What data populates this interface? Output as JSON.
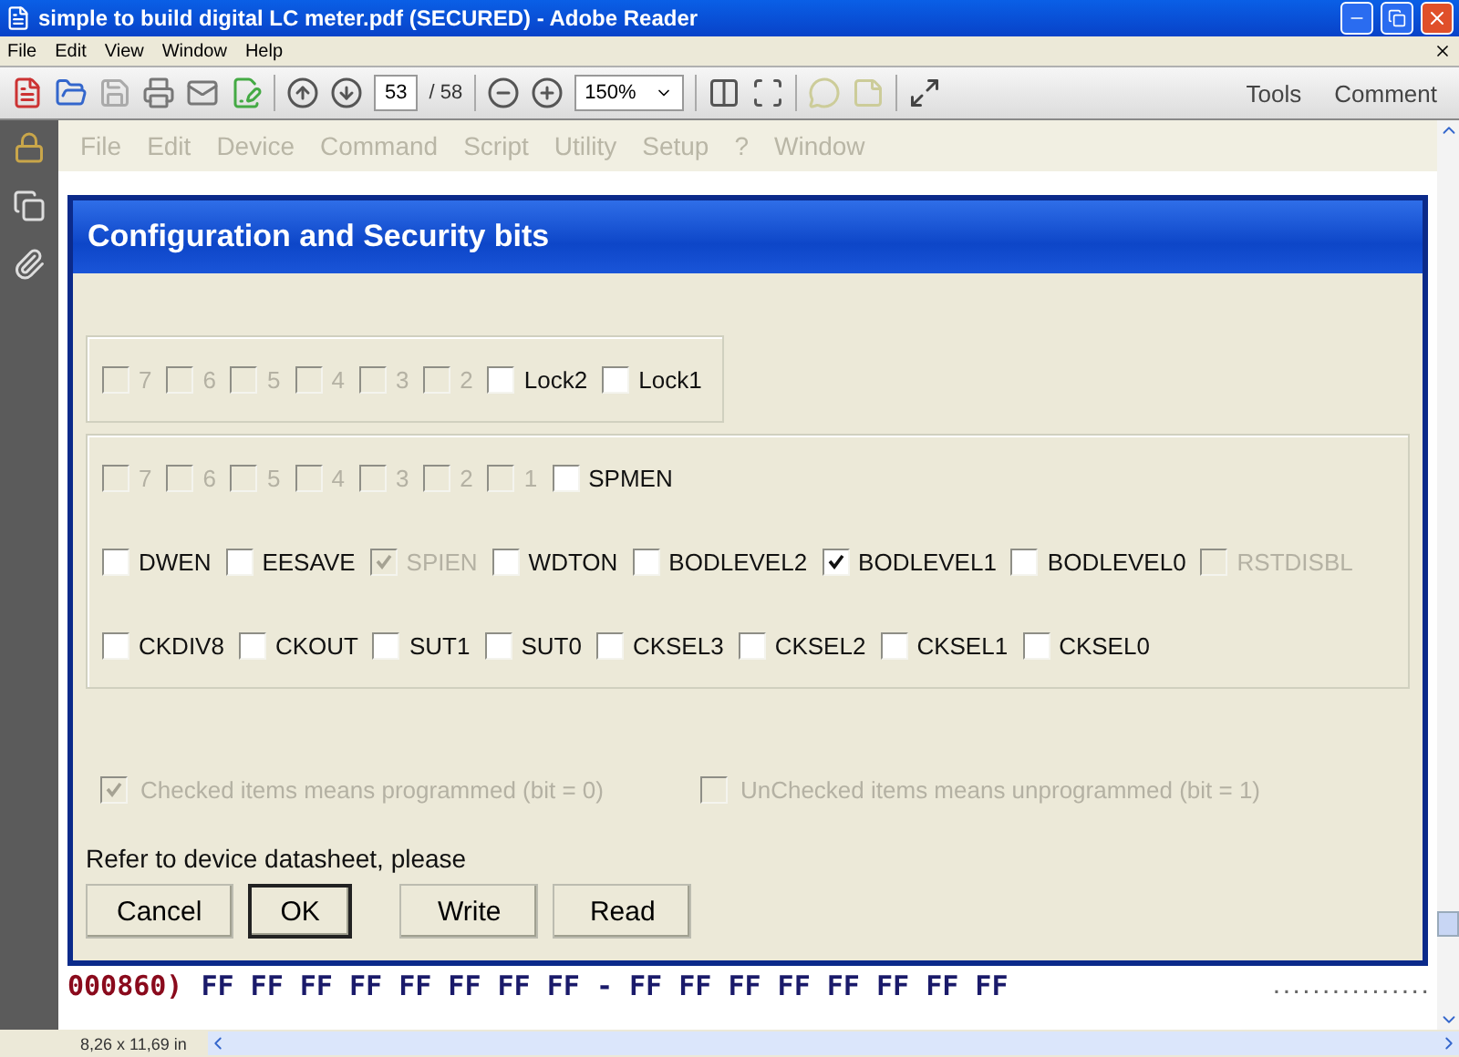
{
  "window": {
    "title": "simple to build digital LC meter.pdf (SECURED) - Adobe Reader"
  },
  "menu": [
    "File",
    "Edit",
    "View",
    "Window",
    "Help"
  ],
  "toolbar": {
    "page": "53",
    "page_count": "/ 58",
    "zoom": "150%",
    "buttons": [
      "Tools",
      "Comment"
    ]
  },
  "document": {
    "app_menu": [
      "File",
      "Edit",
      "Device",
      "Command",
      "Script",
      "Utility",
      "Setup",
      "?",
      "Window"
    ],
    "dialog": {
      "title": "Configuration and Security bits",
      "lock_bits": [
        {
          "label": "7",
          "checked": false,
          "disabled": true
        },
        {
          "label": "6",
          "checked": false,
          "disabled": true
        },
        {
          "label": "5",
          "checked": false,
          "disabled": true
        },
        {
          "label": "4",
          "checked": false,
          "disabled": true
        },
        {
          "label": "3",
          "checked": false,
          "disabled": true
        },
        {
          "label": "2",
          "checked": false,
          "disabled": true
        },
        {
          "label": "Lock2",
          "checked": false,
          "disabled": false
        },
        {
          "label": "Lock1",
          "checked": false,
          "disabled": false
        }
      ],
      "fuse_rows": [
        {
          "bits": [
            {
              "label": "7",
              "checked": false,
              "disabled": true
            },
            {
              "label": "6",
              "checked": false,
              "disabled": true
            },
            {
              "label": "5",
              "checked": false,
              "disabled": true
            },
            {
              "label": "4",
              "checked": false,
              "disabled": true
            },
            {
              "label": "3",
              "checked": false,
              "disabled": true
            },
            {
              "label": "2",
              "checked": false,
              "disabled": true
            },
            {
              "label": "1",
              "checked": false,
              "disabled": true
            },
            {
              "label": "SPMEN",
              "checked": false,
              "disabled": false
            }
          ]
        },
        {
          "bits": [
            {
              "label": "DWEN",
              "checked": false,
              "disabled": false
            },
            {
              "label": "EESAVE",
              "checked": false,
              "disabled": false
            },
            {
              "label": "SPIEN",
              "checked": true,
              "disabled": true
            },
            {
              "label": "WDTON",
              "checked": false,
              "disabled": false
            },
            {
              "label": "BODLEVEL2",
              "checked": false,
              "disabled": false
            },
            {
              "label": "BODLEVEL1",
              "checked": true,
              "disabled": false
            },
            {
              "label": "BODLEVEL0",
              "checked": false,
              "disabled": false
            },
            {
              "label": "RSTDISBL",
              "checked": false,
              "disabled": true
            }
          ]
        },
        {
          "bits": [
            {
              "label": "CKDIV8",
              "checked": false,
              "disabled": false
            },
            {
              "label": "CKOUT",
              "checked": false,
              "disabled": false
            },
            {
              "label": "SUT1",
              "checked": false,
              "disabled": false
            },
            {
              "label": "SUT0",
              "checked": false,
              "disabled": false
            },
            {
              "label": "CKSEL3",
              "checked": false,
              "disabled": false
            },
            {
              "label": "CKSEL2",
              "checked": false,
              "disabled": false
            },
            {
              "label": "CKSEL1",
              "checked": false,
              "disabled": false
            },
            {
              "label": "CKSEL0",
              "checked": false,
              "disabled": false
            }
          ]
        }
      ],
      "legend": [
        {
          "label": "Checked items means programmed (bit = 0)",
          "checked": true,
          "disabled": true
        },
        {
          "label": "UnChecked items means unprogrammed (bit = 1)",
          "checked": false,
          "disabled": true
        }
      ],
      "note": "Refer to device datasheet, please",
      "buttons": [
        {
          "label": "Cancel",
          "default": false
        },
        {
          "label": "OK",
          "default": true
        },
        {
          "label": "Write",
          "default": false
        },
        {
          "label": "Read",
          "default": false
        }
      ]
    },
    "hex_rows": [
      {
        "address": "000860)",
        "bytes": "FF FF FF FF FF FF FF FF - FF FF FF FF FF FF FF FF",
        "ascii": "................"
      }
    ]
  },
  "status_bar": {
    "page_size": "8,26 x 11,69 in"
  }
}
